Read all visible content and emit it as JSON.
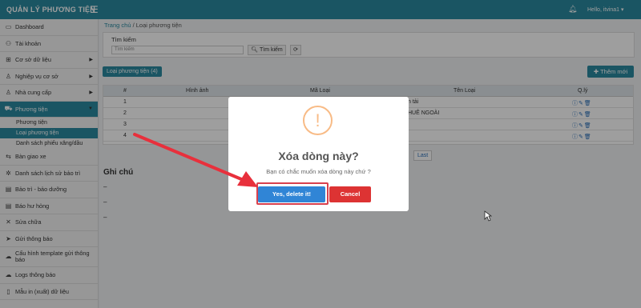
{
  "app": {
    "title": "QUẢN LÝ PHƯƠNG TIỆN",
    "menu_icon": "hamburger-icon",
    "user_greeting": "Hello, itvina1 ▾",
    "notification_icon": "bell-icon"
  },
  "sidebar": {
    "items": [
      {
        "label": "Dashboard",
        "icon": "monitor-icon",
        "glyph": "▭"
      },
      {
        "label": "Tài khoản",
        "icon": "users-icon",
        "glyph": "⚇"
      },
      {
        "label": "Cơ sở dữ liệu",
        "icon": "table-icon",
        "glyph": "⊞",
        "caret": "▶"
      },
      {
        "label": "Nghiệp vụ cơ sở",
        "icon": "user-icon",
        "glyph": "♙",
        "caret": "▶"
      },
      {
        "label": "Nhà cung cấp",
        "icon": "user-icon",
        "glyph": "♙",
        "caret": "▶"
      },
      {
        "label": "Phương tiện",
        "icon": "car-icon",
        "glyph": "⛟",
        "caret": "▼"
      }
    ],
    "sub_items": [
      {
        "label": "Phương tiện"
      },
      {
        "label": "Loại phương tiện"
      },
      {
        "label": "Danh sách phiếu xăng/dầu"
      }
    ],
    "items_after": [
      {
        "label": "Bàn giao xe",
        "icon": "exchange-icon",
        "glyph": "⇆"
      },
      {
        "label": "Danh sách lịch sử bảo trì",
        "icon": "wrench-icon",
        "glyph": "✲"
      },
      {
        "label": "Bảo trì - bảo dưỡng",
        "icon": "calendar-icon",
        "glyph": "▤"
      },
      {
        "label": "Báo hư hỏng",
        "icon": "calendar-icon",
        "glyph": "▤"
      },
      {
        "label": "Sửa chữa",
        "icon": "tools-icon",
        "glyph": "✕"
      },
      {
        "label": "Gửi thông báo",
        "icon": "send-icon",
        "glyph": "➤"
      },
      {
        "label": "Cấu hình template gửi thông báo",
        "icon": "cloud-icon",
        "glyph": "☁"
      },
      {
        "label": "Logs thông báo",
        "icon": "cloud-icon",
        "glyph": "☁"
      },
      {
        "label": "Mẫu in (xuất) dữ liệu",
        "icon": "file-icon",
        "glyph": "▯"
      }
    ]
  },
  "breadcrumb": {
    "home": "Trang chủ",
    "separator": " / ",
    "current": "Loại phương tiện"
  },
  "search": {
    "label": "Tìm kiếm",
    "placeholder": "Tìm kiếm",
    "button_label": "Tìm kiếm",
    "button_icon": "search-icon",
    "refresh_icon": "refresh-icon"
  },
  "list": {
    "tab_label": "Loại phương tiện (4)",
    "add_button_label": "Thêm mới",
    "add_icon": "plus-icon"
  },
  "table": {
    "columns": [
      "#",
      "Hình ảnh",
      "Mã Loại",
      "Tên Loại",
      "Q.lý"
    ],
    "rows": [
      {
        "num": "1",
        "name_fragment": "n tải"
      },
      {
        "num": "2",
        "name_fragment": "HUÊ NGOÀI"
      },
      {
        "num": "3",
        "name_fragment": ""
      },
      {
        "num": "4",
        "name_fragment": ""
      }
    ],
    "action_icons": [
      "info-icon",
      "edit-icon",
      "trash-icon"
    ]
  },
  "pagination": {
    "last_label": "Last"
  },
  "notes": {
    "title": "Ghi chú",
    "lines": [
      "–",
      "–",
      "–"
    ]
  },
  "modal": {
    "icon": "warning-icon",
    "icon_glyph": "!",
    "title": "Xóa dòng này?",
    "text": "Bạn có chắc muốn xóa dòng này chứ ?",
    "confirm_label": "Yes, delete it!",
    "cancel_label": "Cancel",
    "confirm_color": "#3085d6",
    "cancel_color": "#dd3333",
    "highlight_color": "#d9404d"
  },
  "annotation": {
    "arrow_color": "#e8303c"
  }
}
